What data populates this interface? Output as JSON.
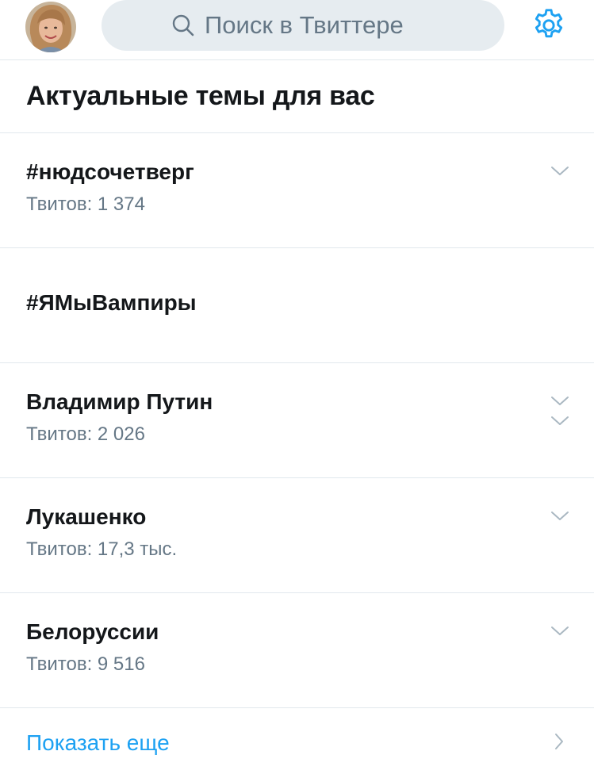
{
  "header": {
    "avatar_alt": "profile avatar",
    "search_placeholder": "Поиск в Твиттере",
    "icons": {
      "search": "search-icon",
      "settings": "gear-icon"
    },
    "accent_color": "#1da1f2"
  },
  "trends_section": {
    "title": "Актуальные темы для вас",
    "items": [
      {
        "name": "#нюдсочетверг",
        "count": "Твитов: 1 374"
      },
      {
        "name": "#ЯМыВампиры",
        "count": ""
      },
      {
        "name": "Владимир Путин",
        "count": "Твитов: 2 026"
      },
      {
        "name": "Лукашенко",
        "count": "Твитов: 17,3 тыс."
      },
      {
        "name": "Белоруссии",
        "count": "Твитов: 9 516"
      }
    ],
    "show_more": "Показать еще"
  }
}
